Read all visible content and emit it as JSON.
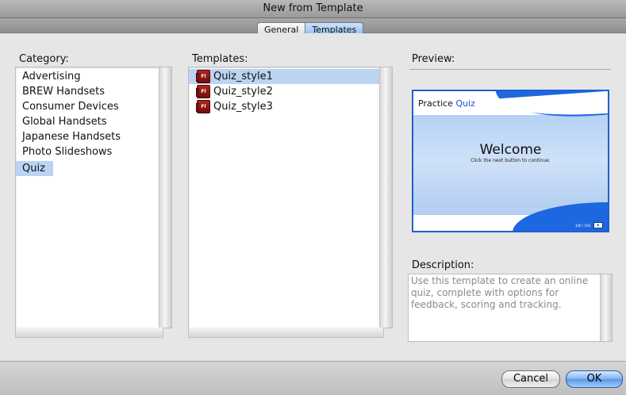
{
  "window": {
    "title": "New from Template"
  },
  "tabs": [
    {
      "label": "General",
      "active": false
    },
    {
      "label": "Templates",
      "active": true
    }
  ],
  "category": {
    "label": "Category:",
    "items": [
      "Advertising",
      "BREW Handsets",
      "Consumer Devices",
      "Global Handsets",
      "Japanese Handsets",
      "Photo Slideshows",
      "Quiz"
    ],
    "selected": "Quiz"
  },
  "templates": {
    "label": "Templates:",
    "items": [
      "Quiz_style1",
      "Quiz_style2",
      "Quiz_style3"
    ],
    "selected": "Quiz_style1",
    "icon": "flash-document-icon",
    "icon_text": "Fl"
  },
  "preview": {
    "label": "Preview:",
    "slide_title_prefix": "Practice ",
    "slide_title_accent": "Quiz",
    "welcome": "Welcome",
    "subtitle": "Click the next button to continue.",
    "page_indicator": "100 / 100",
    "next_glyph": "▸",
    "accent_color": "#1d67e0"
  },
  "description": {
    "label": "Description:",
    "text": "Use this template to create an online quiz, complete with options for feedback, scoring and tracking."
  },
  "buttons": {
    "cancel": "Cancel",
    "ok": "OK"
  }
}
